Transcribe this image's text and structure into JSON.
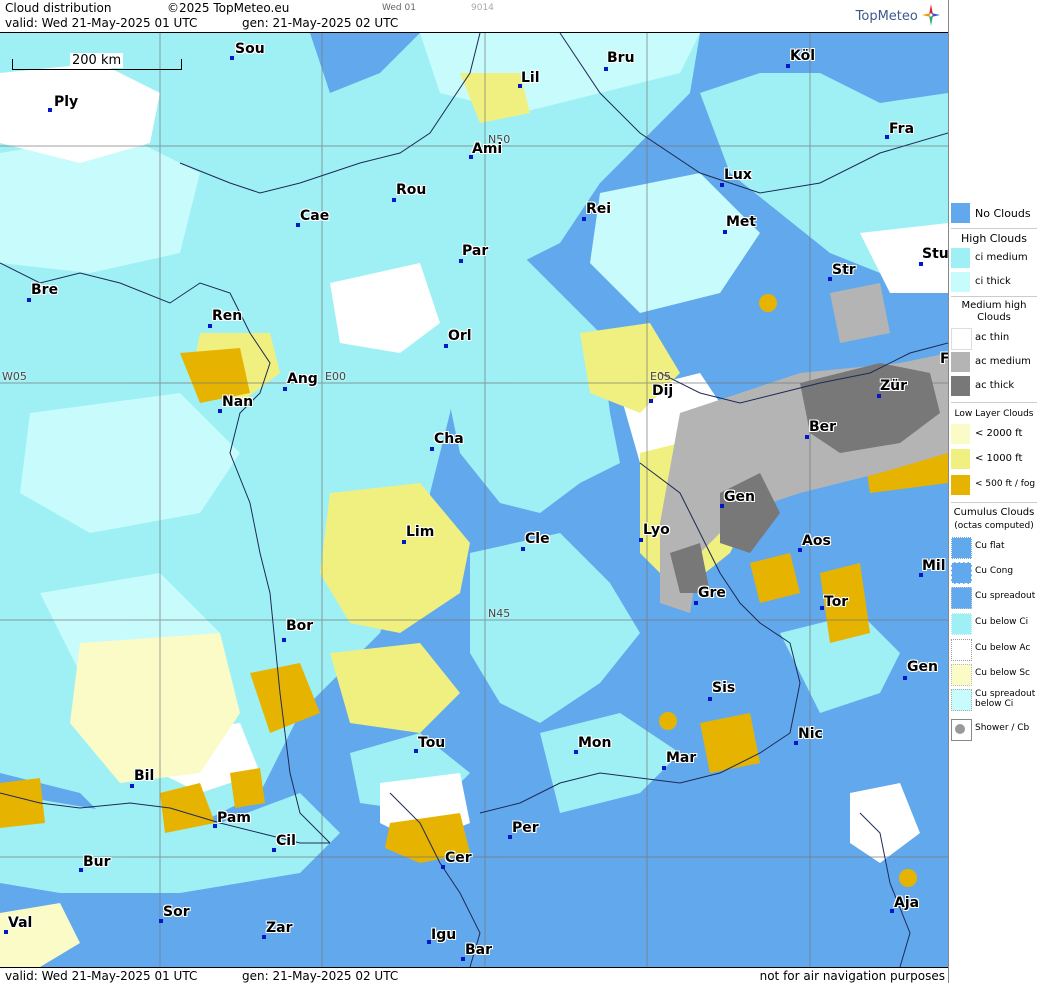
{
  "header": {
    "title": "Cloud distribution",
    "copyright": "©2025 TopMeteo.eu",
    "run": "Wed 01",
    "code": "9014",
    "valid": "valid:  Wed  21-May-2025  01 UTC",
    "gen": "gen: 21-May-2025 02 UTC",
    "logo": "TopMeteo"
  },
  "scale": {
    "label": "200 km"
  },
  "grid_labels": [
    "N50",
    "N45",
    "W05",
    "E00",
    "E05"
  ],
  "cities": [
    "Sou",
    "Ply",
    "Lil",
    "Bru",
    "Köl",
    "Fra",
    "Ami",
    "Lux",
    "Rou",
    "Cae",
    "Rei",
    "Met",
    "Par",
    "Stu",
    "Str",
    "Bre",
    "Ren",
    "Orl",
    "Ang",
    "Nan",
    "Dij",
    "Zür",
    "Ber",
    "Cha",
    "Gen",
    "Lim",
    "Cle",
    "Lyo",
    "Aos",
    "Mil",
    "Gre",
    "Tor",
    "Bor",
    "Gen",
    "Sis",
    "Nic",
    "Tou",
    "Mon",
    "Mar",
    "Bil",
    "Pam",
    "Cil",
    "Per",
    "Cer",
    "Bur",
    "Sor",
    "Zar",
    "Val",
    "Igu",
    "Bar",
    "Aja",
    "F"
  ],
  "footer": {
    "valid": "valid:  Wed  21-May-2025  01 UTC",
    "gen": "gen: 21-May-2025 02 UTC",
    "disclaimer": "not for air navigation purposes"
  },
  "legend": {
    "no_clouds": "No Clouds",
    "high_title": "High Clouds",
    "ci_medium": "ci medium",
    "ci_thick": "ci thick",
    "medium_title": "Medium high Clouds",
    "ac_thin": "ac thin",
    "ac_medium": "ac medium",
    "ac_thick": "ac thick",
    "low_title": "Low Layer Clouds",
    "low_2000": "< 2000 ft",
    "low_1000": "< 1000 ft",
    "low_500": "< 500 ft / fog",
    "cumulus_title": "Cumulus Clouds",
    "cumulus_sub": "(octas computed)",
    "cu_flat": "Cu flat",
    "cu_cong": "Cu Cong",
    "cu_spreadout": "Cu spreadout",
    "cu_below_ci": "Cu below Ci",
    "cu_below_ac": "Cu below Ac",
    "cu_below_sc": "Cu below Sc",
    "cu_spreadout_below_ci": "Cu spreadout below Ci",
    "shower": "Shower / Cb"
  },
  "colors": {
    "no_clouds": "#62a8ec",
    "ci_medium": "#9ff0f5",
    "ci_thick": "#c8fbfb",
    "ac_thin": "#ffffff",
    "ac_medium": "#b4b4b4",
    "ac_thick": "#787878",
    "low_2000": "#fbfbc8",
    "low_1000": "#f0f080",
    "low_500": "#e6b400",
    "dot": "#0018c8"
  }
}
